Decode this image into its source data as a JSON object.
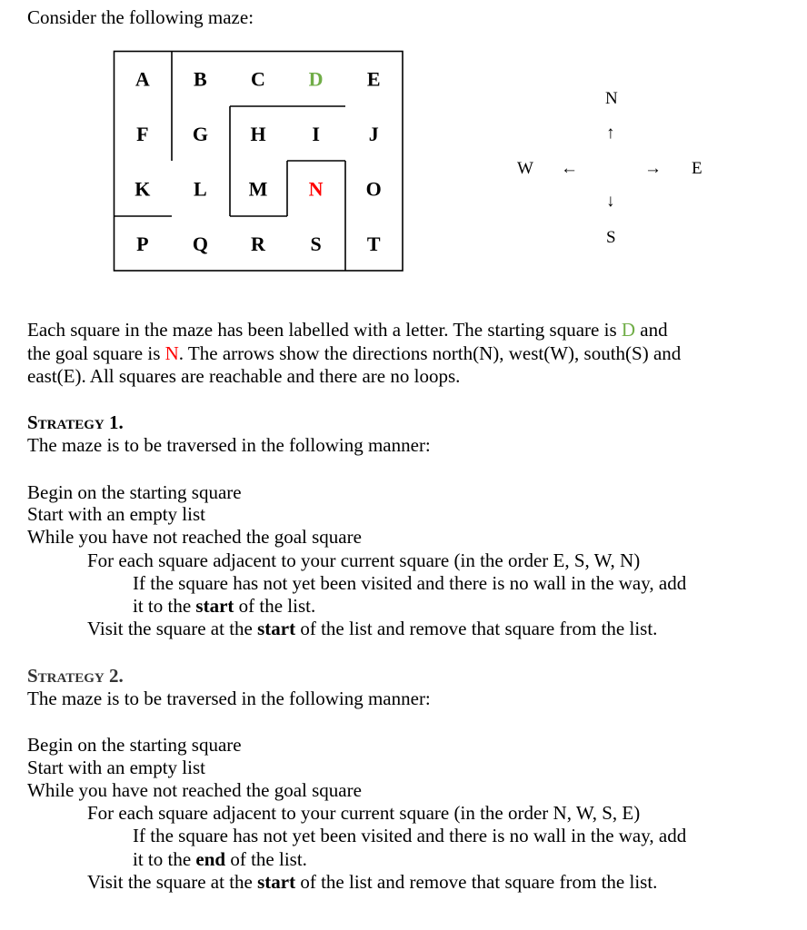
{
  "intro": "Consider the following maze:",
  "maze": {
    "rows": [
      [
        "A",
        "B",
        "C",
        "D",
        "E"
      ],
      [
        "F",
        "G",
        "H",
        "I",
        "J"
      ],
      [
        "K",
        "L",
        "M",
        "N",
        "O"
      ],
      [
        "P",
        "Q",
        "R",
        "S",
        "T"
      ]
    ],
    "start": "D",
    "goal": "N",
    "start_color": "#70ad47",
    "goal_color": "#ff0000"
  },
  "compass": {
    "north": "N",
    "south": "S",
    "west": "W",
    "east": "E",
    "north_arrow": "↑",
    "south_arrow": "↓",
    "west_arrow": "←",
    "east_arrow": "→"
  },
  "description": {
    "line1_pre": "Each square in the maze has been labelled with a letter. The starting square is ",
    "start": "D",
    "line1_post": " and",
    "line2_pre": "the goal square is ",
    "goal": "N",
    "line2_post": ". The arrows show the directions north(N), west(W), south(S) and",
    "line3": "east(E). All squares are reachable and there are no loops."
  },
  "strategy1": {
    "heading": "Strategy 1.",
    "intro": "The maze is to be traversed in the following manner:",
    "step1": "Begin on the starting square",
    "step2": "Start with an empty list",
    "step3": "While you have not reached the goal square",
    "step4": "For each square adjacent to your current square (in the order E, S, W, N)",
    "step5": "If the square has not yet been visited and there is no wall in the way, add",
    "step6_pre": "it to the ",
    "step6_bold": "start",
    "step6_post": " of the list.",
    "step7_pre": "Visit the square at the ",
    "step7_bold": "start",
    "step7_post": " of the list and remove that square from the list."
  },
  "strategy2": {
    "heading": "Strategy 2.",
    "intro": "The maze is to be traversed in the following manner:",
    "step1": "Begin on the starting square",
    "step2": "Start with an empty list",
    "step3": "While you have not reached the goal square",
    "step4": "For each square adjacent to your current square (in the order N, W, S, E)",
    "step5": "If the square has not yet been visited and there is no wall in the way, add",
    "step6_pre": "it to the ",
    "step6_bold": "end",
    "step6_post": " of the list.",
    "step7_pre": "Visit the square at the ",
    "step7_bold": "start",
    "step7_post": " of the list and remove that square from the list."
  }
}
